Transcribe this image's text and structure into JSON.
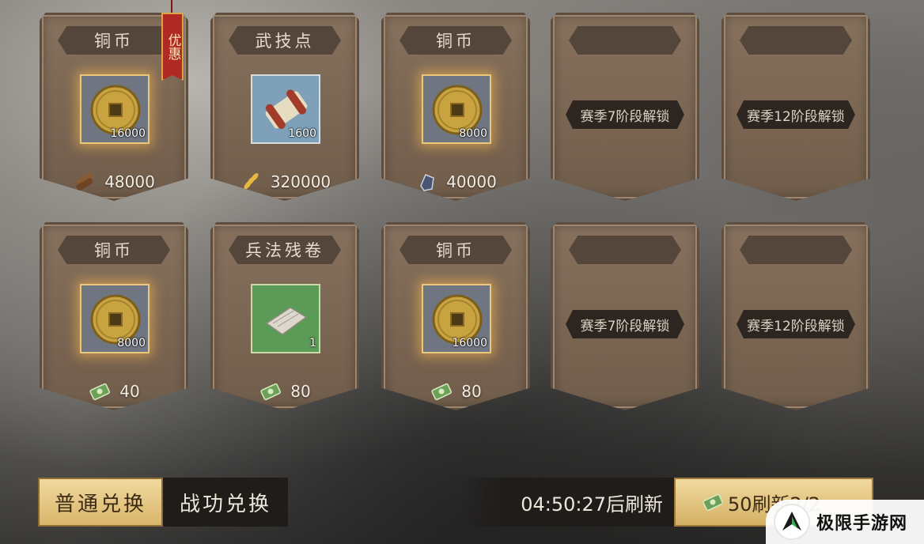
{
  "cards": [
    {
      "title": "铜币",
      "item": "coin",
      "quantity": "16000",
      "cost_icon": "wood-icon",
      "cost": "48000",
      "promo": "优惠"
    },
    {
      "title": "武技点",
      "item": "scroll",
      "quantity": "1600",
      "cost_icon": "wheat-icon",
      "cost": "320000"
    },
    {
      "title": "铜币",
      "item": "coin",
      "quantity": "8000",
      "cost_icon": "iron-ore-icon",
      "cost": "40000"
    },
    {
      "title": "",
      "locked_text": "赛季7阶段解锁"
    },
    {
      "title": "",
      "locked_text": "赛季12阶段解锁"
    },
    {
      "title": "铜币",
      "item": "coin",
      "quantity": "8000",
      "cost_icon": "cash-icon",
      "cost": "40"
    },
    {
      "title": "兵法残卷",
      "item": "tactics-scroll",
      "quantity": "1",
      "cost_icon": "cash-icon",
      "cost": "80"
    },
    {
      "title": "铜币",
      "item": "coin",
      "quantity": "16000",
      "cost_icon": "cash-icon",
      "cost": "80"
    },
    {
      "title": "",
      "locked_text": "赛季7阶段解锁"
    },
    {
      "title": "",
      "locked_text": "赛季12阶段解锁"
    }
  ],
  "tabs": [
    {
      "label": "普通兑换",
      "active": true
    },
    {
      "label": "战功兑换",
      "active": false
    }
  ],
  "refresh": {
    "countdown_text": "04:50:27后刷新",
    "button_label": "50刷新2/2"
  },
  "watermark": {
    "text": "极限手游网"
  },
  "colors": {
    "gold": "#e9c77b",
    "card": "#7b6653",
    "promo_red": "#b02a23"
  }
}
